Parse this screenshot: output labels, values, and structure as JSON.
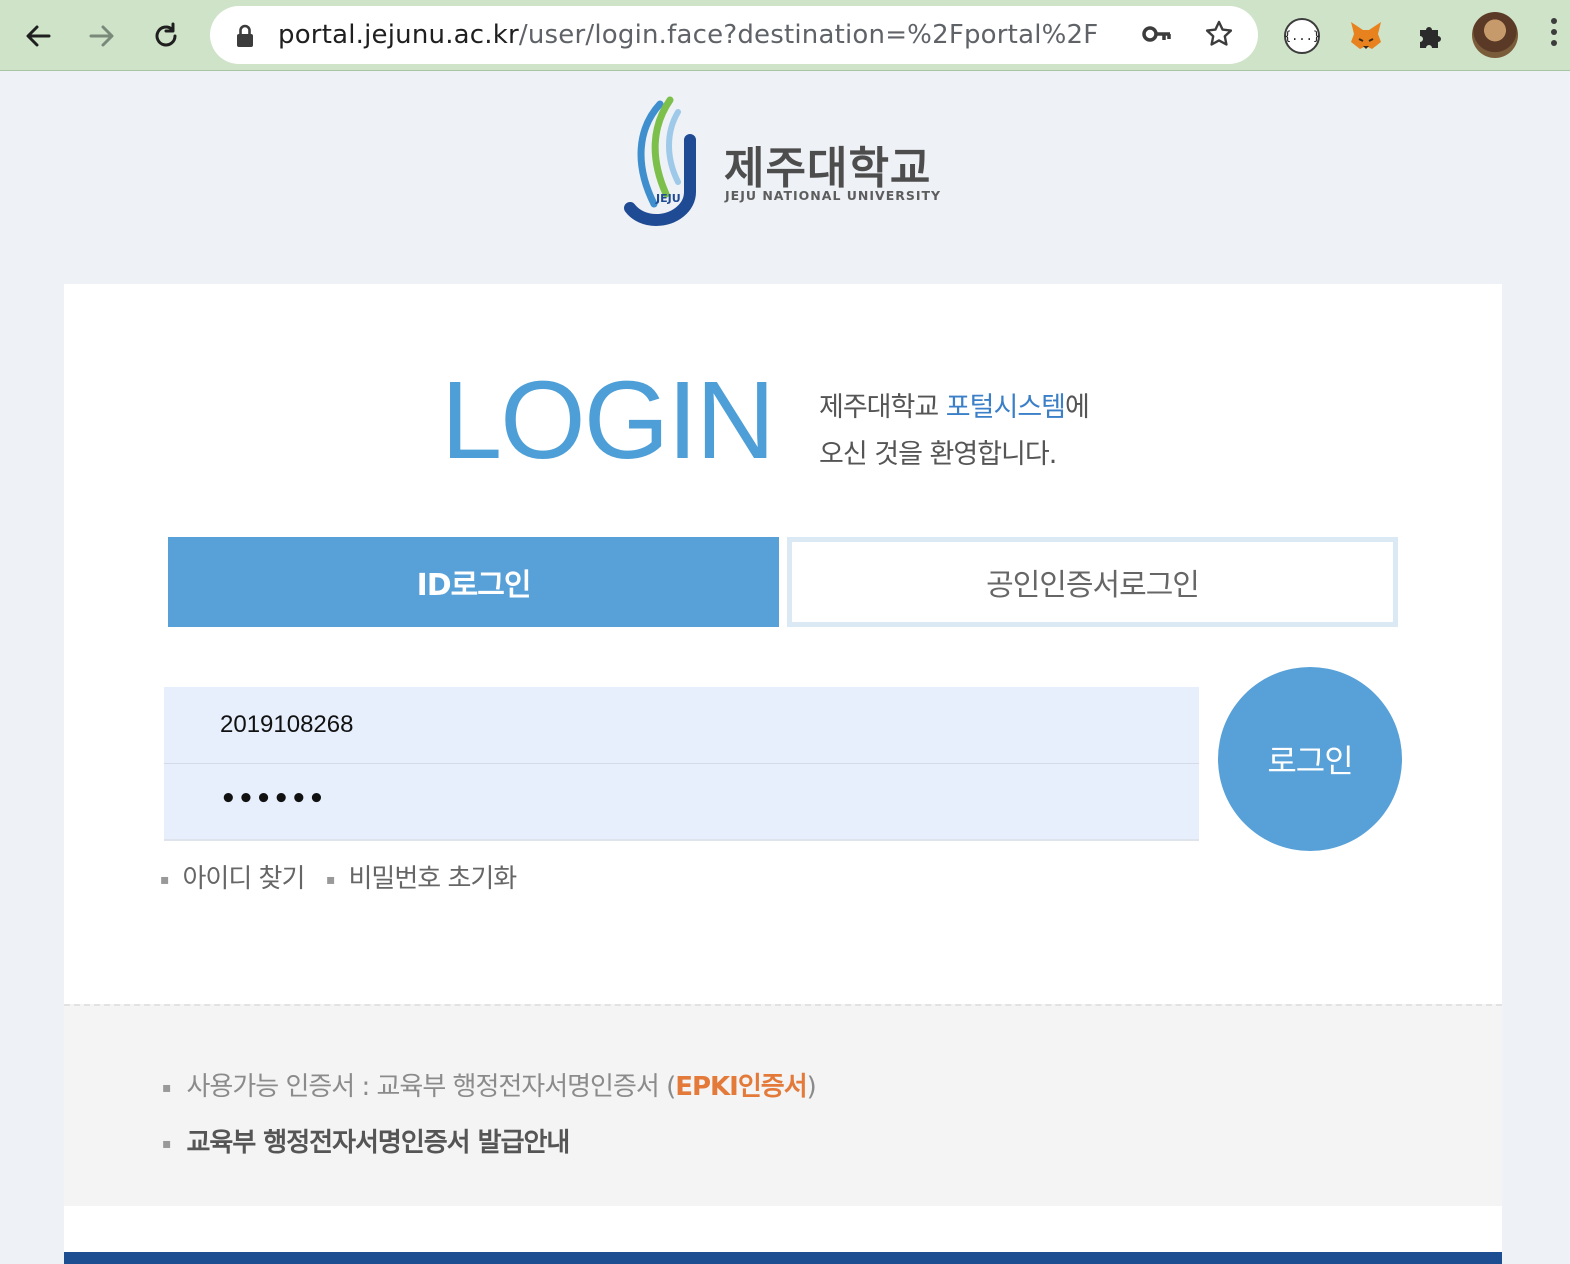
{
  "browser": {
    "url_host": "portal.jejunu.ac.kr",
    "url_path": "/user/login.face?destination=%2Fportal%2F",
    "icons": [
      "back-arrow-icon",
      "forward-arrow-icon",
      "reload-icon",
      "lock-icon",
      "key-icon",
      "star-icon",
      "json-extension-icon",
      "fox-extension-icon",
      "puzzle-icon",
      "profile-avatar",
      "menu-dots-icon"
    ],
    "json_ext_label": "{...}"
  },
  "logo": {
    "name_ko": "제주대학교",
    "name_en": "JEJU NATIONAL UNIVERSITY",
    "emblem_text": "JEJU"
  },
  "login": {
    "title": "LOGIN",
    "welcome_line1_prefix": "제주대학교 ",
    "welcome_line1_highlight": "포털시스템",
    "welcome_line1_suffix": "에",
    "welcome_line2": "오신 것을 환영합니다."
  },
  "tabs": {
    "id_login": "ID로그인",
    "cert_login": "공인인증서로그인"
  },
  "form": {
    "id_value": "2019108268",
    "password_mask": "••••••",
    "submit_label": "로그인"
  },
  "helpers": {
    "find_id": "아이디 찾기",
    "reset_password": "비밀번호 초기화"
  },
  "notice": {
    "line1_prefix": "사용가능 인증서 : 교육부 행정전자서명인증서 (",
    "line1_highlight": "EPKI인증서",
    "line1_suffix": ")",
    "line2": "교육부 행정전자서명인증서 발급안내"
  },
  "colors": {
    "primary": "#57a0d8",
    "title": "#4e9fd7",
    "accent_orange": "#e37a3a",
    "footer": "#1e4e92"
  }
}
